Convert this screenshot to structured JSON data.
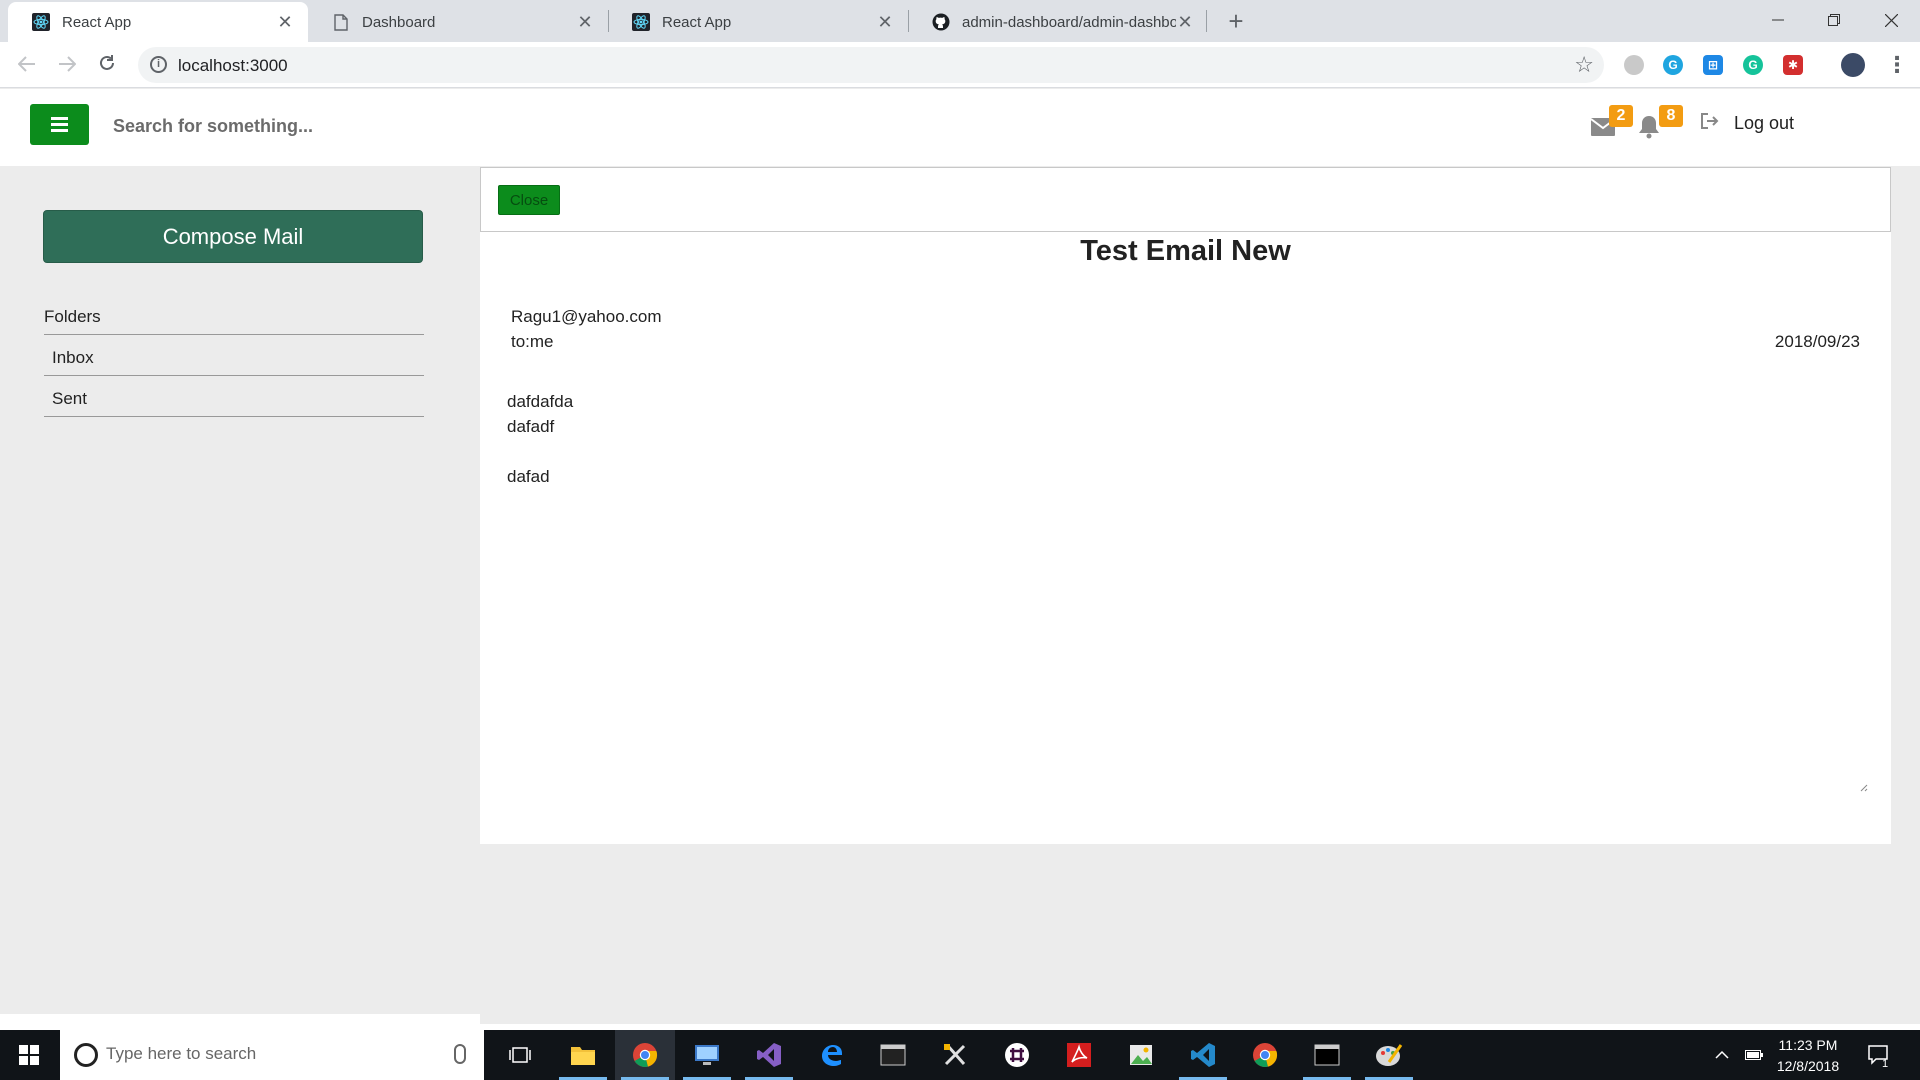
{
  "browser": {
    "tabs": [
      {
        "title": "React App",
        "active": true
      },
      {
        "title": "Dashboard",
        "active": false
      },
      {
        "title": "React App",
        "active": false
      },
      {
        "title": "admin-dashboard/admin-dashbo",
        "active": false
      }
    ],
    "url": "localhost:3000",
    "new_tab_symbol": "+",
    "close_symbol": "✕"
  },
  "header": {
    "search_placeholder": "Search for something...",
    "mail_count": "2",
    "notification_count": "8",
    "logout_label": "Log out",
    "accent_color": "#0c8c1c",
    "badge_color": "#f39c12"
  },
  "sidebar": {
    "compose_label": "Compose Mail",
    "folders_heading": "Folders",
    "items": [
      {
        "label": "Inbox"
      },
      {
        "label": "Sent"
      }
    ],
    "compose_color": "#2f6e58"
  },
  "mail": {
    "close_label": "Close",
    "subject": "Test Email New",
    "from": "Ragu1@yahoo.com",
    "to": "to:me",
    "date": "2018/09/23",
    "body_lines": [
      "dafdafda",
      "dafadf",
      "",
      "dafad"
    ]
  },
  "taskbar": {
    "search_placeholder": "Type here to search",
    "time": "11:23 PM",
    "date": "12/8/2018",
    "notification_count": "1",
    "apps": [
      "file-explorer",
      "chrome",
      "remote-desktop",
      "visual-studio",
      "edge",
      "terminal",
      "tools",
      "slack",
      "acrobat",
      "photos",
      "vscode",
      "chrome",
      "console",
      "paint"
    ]
  }
}
